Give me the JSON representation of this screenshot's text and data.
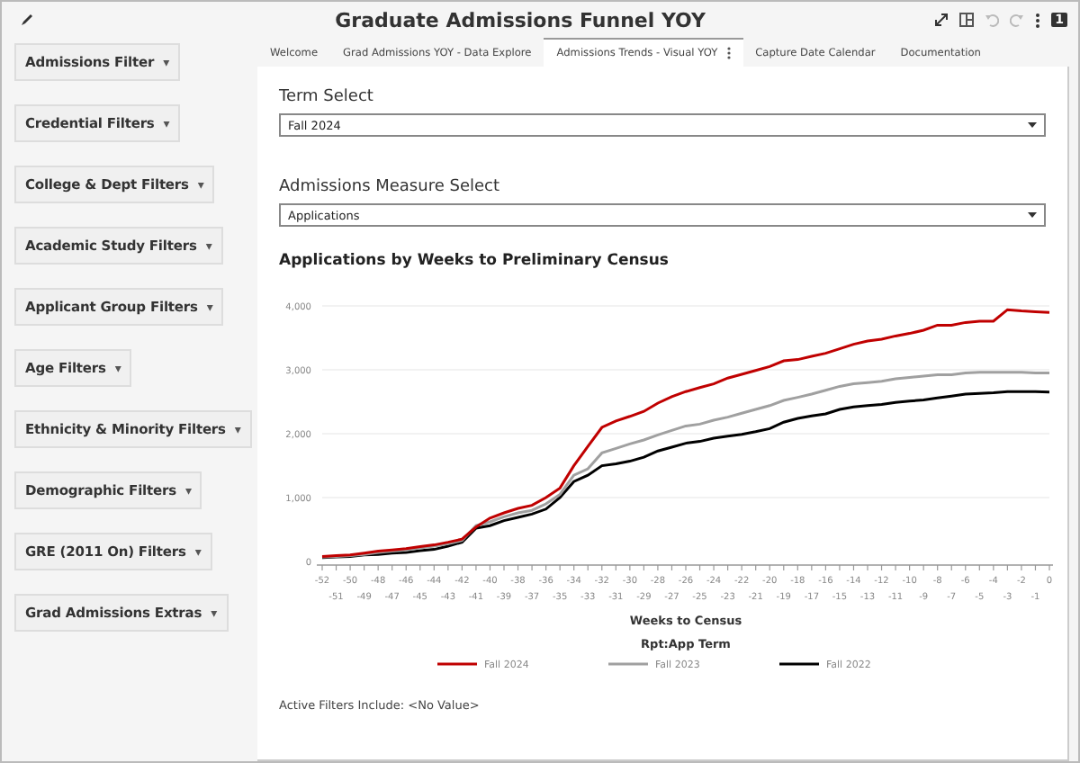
{
  "header": {
    "title": "Graduate Admissions Funnel YOY",
    "badge": "1"
  },
  "filters": [
    {
      "label": "Admissions Filter",
      "caret": "▾"
    },
    {
      "label": "Credential Filters",
      "caret": "▾"
    },
    {
      "label": "College & Dept Filters",
      "caret": "▾"
    },
    {
      "label": "Academic Study Filters",
      "caret": "▾"
    },
    {
      "label": "Applicant Group Filters",
      "caret": "▾"
    },
    {
      "label": "Age Filters",
      "caret": "▾"
    },
    {
      "label": "Ethnicity & Minority Filters",
      "caret": "▾"
    },
    {
      "label": "Demographic Filters",
      "caret": "▾"
    },
    {
      "label": "GRE (2011 On) Filters",
      "caret": "▾"
    },
    {
      "label": "Grad Admissions Extras",
      "caret": "▾"
    }
  ],
  "tabs": [
    {
      "label": "Welcome",
      "selected": false
    },
    {
      "label": "Grad Admissions YOY - Data Explore",
      "selected": false
    },
    {
      "label": "Admissions Trends - Visual YOY",
      "selected": true
    },
    {
      "label": "Capture Date Calendar",
      "selected": false
    },
    {
      "label": "Documentation",
      "selected": false
    }
  ],
  "term_select": {
    "label": "Term Select",
    "value": "Fall 2024"
  },
  "measure_select": {
    "label": "Admissions Measure Select",
    "value": "Applications"
  },
  "chart": {
    "title": "Applications by Weeks to Preliminary Census",
    "chart_data": {
      "type": "line",
      "grid": true,
      "legend": true,
      "xlabel": "Weeks to Census",
      "legend_title": "Rpt:App Term",
      "x": [
        -52,
        -51,
        -50,
        -49,
        -48,
        -47,
        -46,
        -45,
        -44,
        -43,
        -42,
        -41,
        -40,
        -39,
        -38,
        -37,
        -36,
        -35,
        -34,
        -33,
        -32,
        -31,
        -30,
        -29,
        -28,
        -27,
        -26,
        -25,
        -24,
        -23,
        -22,
        -21,
        -20,
        -19,
        -18,
        -17,
        -16,
        -15,
        -14,
        -13,
        -12,
        -11,
        -10,
        -9,
        -8,
        -7,
        -6,
        -5,
        -4,
        -3,
        -2,
        -1,
        0
      ],
      "ylim": [
        0,
        4000
      ],
      "yticks": [
        {
          "value": 0,
          "label": "0"
        },
        {
          "value": 1000,
          "label": "1,000"
        },
        {
          "value": 2000,
          "label": "2,000"
        },
        {
          "value": 3000,
          "label": "3,000"
        },
        {
          "value": 4000,
          "label": "4,000"
        }
      ],
      "series": [
        {
          "name": "Fall 2024",
          "color": "#c00000",
          "values": [
            80,
            90,
            100,
            130,
            160,
            180,
            200,
            230,
            260,
            300,
            350,
            540,
            680,
            760,
            830,
            880,
            1000,
            1150,
            1500,
            1800,
            2100,
            2200,
            2270,
            2350,
            2480,
            2580,
            2660,
            2720,
            2780,
            2870,
            2930,
            2990,
            3050,
            3140,
            3160,
            3210,
            3260,
            3330,
            3400,
            3450,
            3480,
            3530,
            3570,
            3620,
            3700,
            3700,
            3740,
            3760,
            3760,
            3940,
            3920,
            3910,
            3900
          ]
        },
        {
          "name": "Fall 2023",
          "color": "#a0a0a0",
          "values": [
            70,
            80,
            90,
            110,
            140,
            160,
            180,
            210,
            240,
            280,
            330,
            560,
            620,
            700,
            760,
            800,
            900,
            1050,
            1350,
            1450,
            1700,
            1770,
            1840,
            1900,
            1980,
            2050,
            2120,
            2150,
            2210,
            2260,
            2320,
            2380,
            2440,
            2520,
            2570,
            2620,
            2680,
            2740,
            2780,
            2800,
            2820,
            2860,
            2880,
            2900,
            2920,
            2920,
            2950,
            2960,
            2960,
            2960,
            2960,
            2950,
            2950
          ]
        },
        {
          "name": "Fall 2022",
          "color": "#000000",
          "values": [
            60,
            70,
            80,
            100,
            110,
            130,
            140,
            170,
            190,
            240,
            300,
            520,
            560,
            640,
            690,
            740,
            820,
            1000,
            1250,
            1350,
            1500,
            1530,
            1570,
            1630,
            1730,
            1790,
            1850,
            1880,
            1930,
            1960,
            1990,
            2030,
            2080,
            2180,
            2240,
            2280,
            2310,
            2380,
            2420,
            2440,
            2460,
            2490,
            2510,
            2530,
            2560,
            2590,
            2620,
            2630,
            2640,
            2660,
            2660,
            2660,
            2650
          ]
        }
      ]
    }
  },
  "active_filters": "Active Filters Include: <No Value>"
}
